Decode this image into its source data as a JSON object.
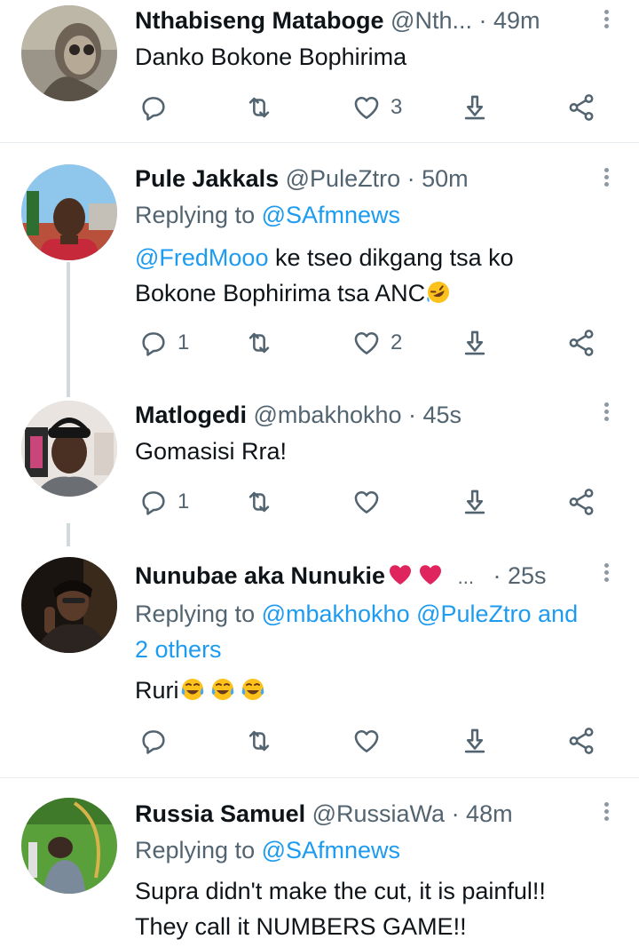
{
  "icons": {
    "reply": "reply-icon",
    "retweet": "retweet-icon",
    "like": "heart-icon",
    "share": "share-icon",
    "download": "download-icon",
    "more": "more-icon"
  },
  "colors": {
    "accent": "#1d9bf0",
    "muted": "#536471",
    "text": "#0f1419",
    "like_red": "#e0245e"
  },
  "tweets": [
    {
      "name": "Nthabiseng Mataboge",
      "handle": "@Nth...",
      "time": "· 49m",
      "lines": [
        "Danko Bokone Bophirima"
      ],
      "reply_count": "",
      "retweet_count": "",
      "like_count": "3"
    },
    {
      "name": "Pule Jakkals",
      "handle": "@PuleZtro",
      "time": "· 50m",
      "replying_prefix": "Replying to ",
      "replying_to": "@SAfmnews",
      "mention": "@FredMooo",
      "lines": [
        " ke tseo dikgang tsa ko",
        "Bokone Bophirima tsa ANC"
      ],
      "reply_count": "1",
      "retweet_count": "",
      "like_count": "2"
    },
    {
      "name": "Matlogedi",
      "handle": "@mbakhokho",
      "time": "· 45s",
      "lines": [
        "Gomasisi Rra!"
      ],
      "reply_count": "1",
      "retweet_count": "",
      "like_count": ""
    },
    {
      "name": "Nunubae aka Nunukie",
      "handle": "...",
      "time": "· 25s",
      "replying_prefix": "Replying to ",
      "replying_to": "@mbakhokho @PuleZtro and",
      "replying_to_2": "2 others",
      "lines": [
        "Ruri"
      ],
      "reply_count": "",
      "retweet_count": "",
      "like_count": ""
    },
    {
      "name": "Russia Samuel",
      "handle": "@RussiaWa",
      "time": "· 48m",
      "replying_prefix": "Replying to ",
      "replying_to": "@SAfmnews",
      "lines": [
        "Supra didn't make the cut, it is painful!!",
        "They call it NUMBERS GAME!!"
      ]
    }
  ]
}
